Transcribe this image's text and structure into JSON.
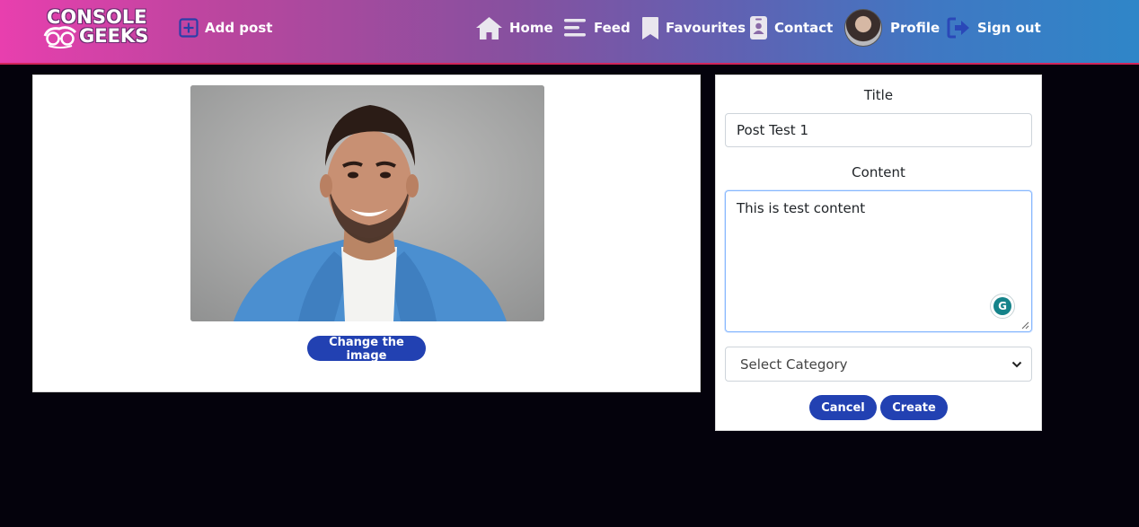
{
  "navbar": {
    "logo_line1": "CONSOLE",
    "logo_line2": "GEEKS",
    "add_post_label": "Add post",
    "links": {
      "home": "Home",
      "feed": "Feed",
      "favourites": "Favourites",
      "contact": "Contact",
      "profile": "Profile",
      "sign_out": "Sign out"
    }
  },
  "image_card": {
    "change_image_label": "Change the image"
  },
  "form": {
    "title_label": "Title",
    "title_value": "Post Test 1",
    "content_label": "Content",
    "content_value": "This is test content",
    "category_selected": "Select Category",
    "cancel_label": "Cancel",
    "create_label": "Create"
  },
  "colors": {
    "primary_button": "#2241b2",
    "page_background": "#04020c"
  }
}
